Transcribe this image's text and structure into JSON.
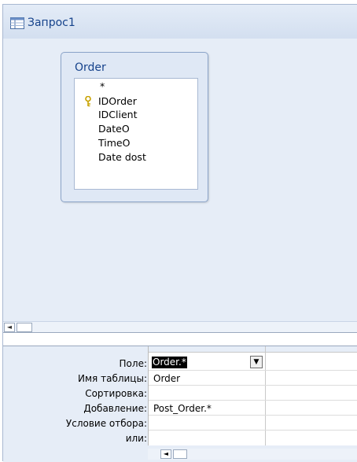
{
  "tab": {
    "title": "Запрос1",
    "icon": "query-icon"
  },
  "table_box": {
    "title": "Order",
    "fields": [
      "*",
      "IDOrder",
      "IDClient",
      "DateO",
      "TimeO",
      "Date dost"
    ],
    "key_field": "IDOrder"
  },
  "grid": {
    "row_labels": {
      "field": "Поле:",
      "table": "Имя таблицы:",
      "sort": "Сортировка:",
      "append": "Добавление:",
      "criteria": "Условие отбора:",
      "or": "или:"
    },
    "column1": {
      "field": "Order.*",
      "table": "Order",
      "sort": "",
      "append": "Post_Order.*",
      "criteria": "",
      "or": ""
    }
  },
  "icons": {
    "scroll_left": "◄",
    "scroll_thumb": "|||",
    "dropdown": "▼"
  }
}
